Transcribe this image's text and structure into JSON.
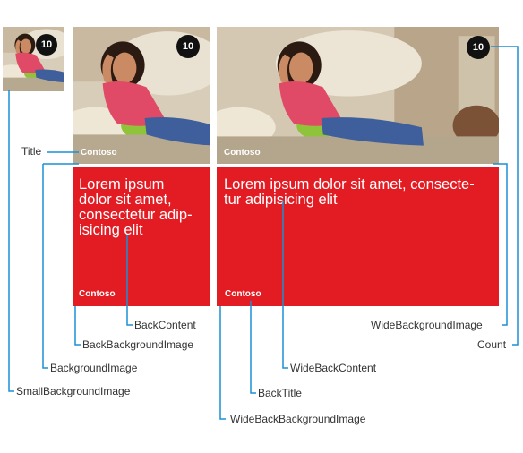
{
  "count": "10",
  "title": "Contoso",
  "back_content": "Lorem ipsum dolor sit amet, consectetur adipisicing elit",
  "back_content_lines": [
    "Lorem ipsum",
    "dolor sit amet,",
    "consectetur adip-",
    "isicing elit"
  ],
  "wide_back_content_lines": [
    "Lorem ipsum dolor sit amet, consecte-",
    "tur adipisicing elit"
  ],
  "back_title": "Contoso",
  "labels": {
    "title": "Title",
    "back_content": "BackContent",
    "back_background_image": "BackBackgroundImage",
    "background_image": "BackgroundImage",
    "small_background_image": "SmallBackgroundImage",
    "wide_background_image": "WideBackgroundImage",
    "count": "Count",
    "wide_back_content": "WideBackContent",
    "back_title": "BackTitle",
    "wide_back_background_image": "WideBackBackgroundImage"
  },
  "colors": {
    "tile_red": "#e31b23",
    "line_blue": "#1a8fd6",
    "badge": "#111111"
  }
}
